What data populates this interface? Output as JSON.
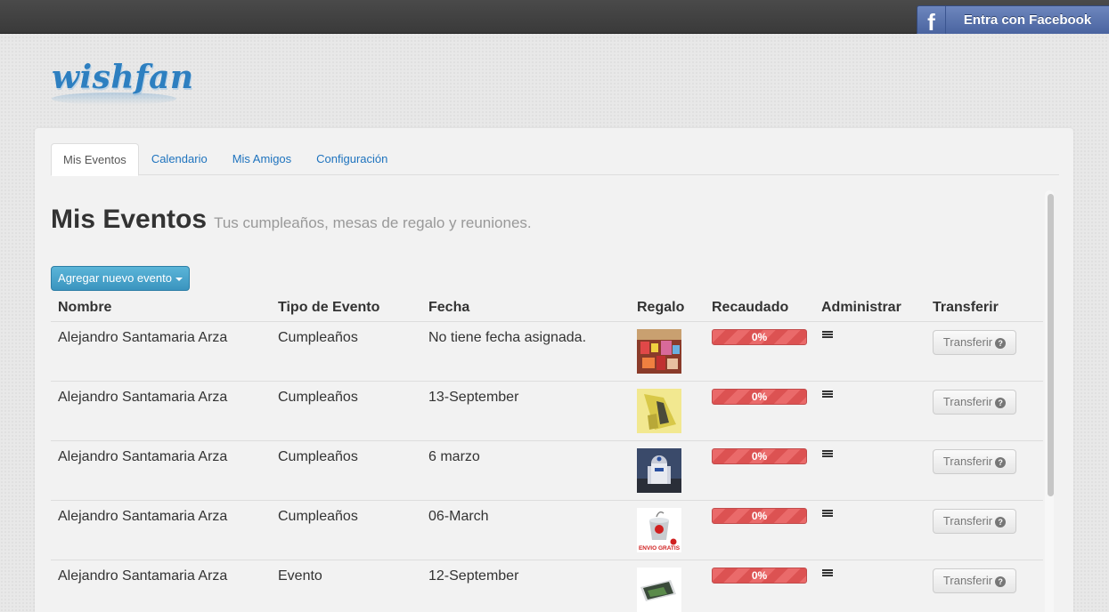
{
  "topbar": {
    "facebook_label": "Entra con Facebook",
    "facebook_glyph": "f"
  },
  "logo": {
    "text": "wishfan"
  },
  "tabs": [
    {
      "label": "Mis Eventos",
      "active": true
    },
    {
      "label": "Calendario"
    },
    {
      "label": "Mis Amigos"
    },
    {
      "label": "Configuración"
    }
  ],
  "page": {
    "title": "Mis Eventos",
    "subtitle": "Tus cumpleaños, mesas de regalo y reuniones.",
    "add_button": "Agregar nuevo evento"
  },
  "table": {
    "headers": {
      "nombre": "Nombre",
      "tipo": "Tipo de Evento",
      "fecha": "Fecha",
      "regalo": "Regalo",
      "recaudado": "Recaudado",
      "administrar": "Administrar",
      "transferir": "Transferir"
    },
    "rows": [
      {
        "nombre": "Alejandro Santamaria Arza",
        "tipo": "Cumpleaños",
        "fecha": "No tiene fecha asignada.",
        "recaudado": "0%",
        "transfer": "Transferir",
        "gift": "toys-store"
      },
      {
        "nombre": "Alejandro Santamaria Arza",
        "tipo": "Cumpleaños",
        "fecha": "13-September",
        "recaudado": "0%",
        "transfer": "Transferir",
        "gift": "yellow-figure"
      },
      {
        "nombre": "Alejandro Santamaria Arza",
        "tipo": "Cumpleaños",
        "fecha": "6 marzo",
        "recaudado": "0%",
        "transfer": "Transferir",
        "gift": "r2d2-robot"
      },
      {
        "nombre": "Alejandro Santamaria Arza",
        "tipo": "Cumpleaños",
        "fecha": "06-March",
        "recaudado": "0%",
        "transfer": "Transferir",
        "gift": "bucket",
        "gift_caption": "ENVIO GRATIS"
      },
      {
        "nombre": "Alejandro Santamaria Arza",
        "tipo": "Evento",
        "fecha": "12-September",
        "recaudado": "0%",
        "transfer": "Transferir",
        "gift": "laptop"
      }
    ]
  },
  "colors": {
    "accent": "#1e73be",
    "progress": "#e05a5a",
    "facebook": "#4a64a0"
  },
  "icons": {
    "menu": "list-menu-icon",
    "help": "question-circle-icon"
  }
}
